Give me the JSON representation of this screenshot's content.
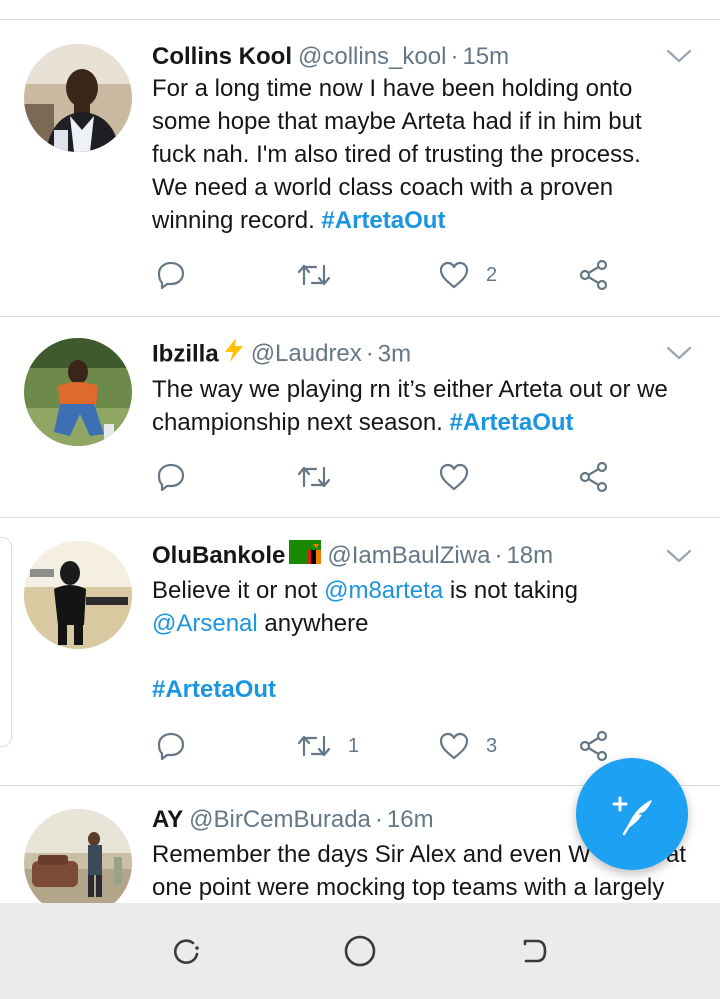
{
  "tweets": [
    {
      "name": "Collins Kool",
      "handle": "@collins_kool",
      "time": "15m",
      "text_lines": [
        "For a long time now I have been holding onto",
        "some hope that maybe Arteta had if in him but",
        "fuck nah. I'm also tired of trusting the process.",
        "We need a world class coach with a proven"
      ],
      "last_line_prefix": "winning record. ",
      "hashtag": "#ArtetaOut",
      "replies": "",
      "retweets": "",
      "likes": "2"
    },
    {
      "name": "Ibzilla",
      "name_emoji": "⚡",
      "handle": "@Laudrex",
      "time": "3m",
      "text_lines": [
        "The way we playing rn it’s either Arteta out or we"
      ],
      "last_line_prefix": "championship next season. ",
      "hashtag": "#ArtetaOut",
      "replies": "",
      "retweets": "",
      "likes": ""
    },
    {
      "name": "OluBankole",
      "name_emoji": "zambia-flag",
      "handle": "@IamBaulZiwa",
      "time": "18m",
      "line1_before": "Believe it or not ",
      "mention1": "@m8arteta",
      "line1_after": " is not taking",
      "mention2": "@Arsenal",
      "line2_after": " anywhere",
      "hashtag": "#ArtetaOut",
      "replies": "",
      "retweets": "1",
      "likes": "3"
    },
    {
      "name": "AY",
      "handle": "@BirCemBurada",
      "time": "16m",
      "text_lines": [
        "Remember the days Sir Alex and even W",
        "one point were mocking top teams with a largely"
      ],
      "line1_tail": "at"
    }
  ],
  "icons": {
    "reply": "reply-icon",
    "retweet": "retweet-icon",
    "like": "heart-icon",
    "share": "share-icon",
    "caret": "chevron-down-icon",
    "compose": "compose-tweet-icon"
  },
  "colors": {
    "accent": "#1da1f2",
    "link": "#1b95e0",
    "muted": "#657786",
    "text": "#14171a"
  },
  "navbar": {
    "recents": "recent-apps-icon",
    "home": "home-icon",
    "back": "back-icon"
  }
}
